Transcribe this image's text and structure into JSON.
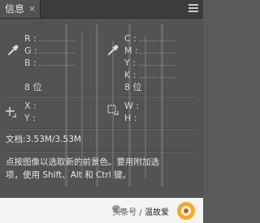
{
  "tab": {
    "title": "信息",
    "close": "×"
  },
  "color1": {
    "labels": [
      "R :",
      "G :",
      "B :"
    ],
    "bit_depth": "8 位"
  },
  "color2": {
    "labels": [
      "C :",
      "M :",
      "Y :",
      "K :"
    ],
    "bit_depth": "8 位"
  },
  "position": {
    "labels": [
      "X :",
      "Y :"
    ]
  },
  "size": {
    "labels": [
      "W :",
      "H :"
    ]
  },
  "document": {
    "label": "文档:3.53M/3.53M"
  },
  "hint": {
    "line1": "点按图像以选取新的前景色。要用附加选",
    "line2": "项，使用 Shift、Alt 和 Ctrl 键。"
  },
  "footer": {
    "prefix": "头条号 /",
    "name": "温故爱"
  },
  "icons": {
    "eyedropper": "eyedropper-icon",
    "crosshair": "crosshair-icon",
    "selection": "selection-size-icon",
    "menu": "panel-menu-icon",
    "wechat": "wechat-icon",
    "logo": "brand-logo-icon"
  }
}
